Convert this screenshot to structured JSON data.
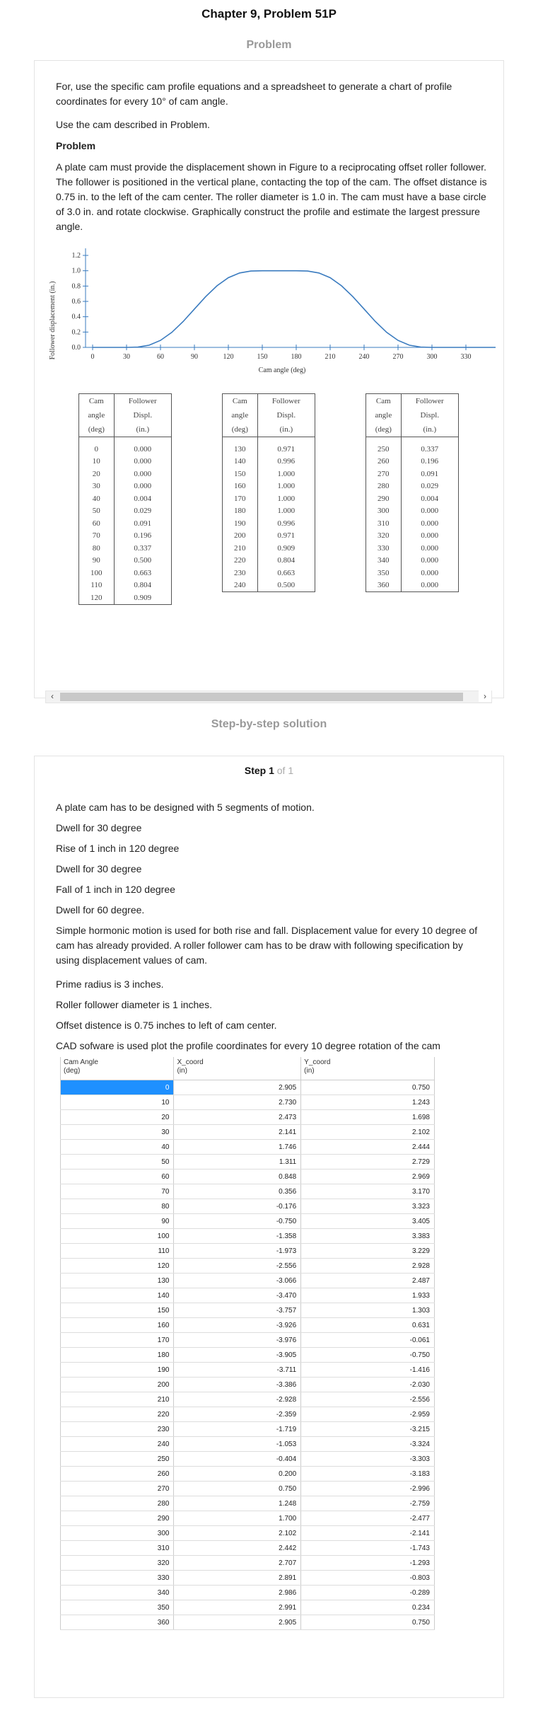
{
  "page_title": "Chapter 9, Problem 51P",
  "problem_section": {
    "heading": "Problem",
    "intro": "For, use the specific cam profile equations and a spreadsheet to generate a chart of profile coordinates for every 10° of cam angle.",
    "use_cam": "Use the cam described in Problem.",
    "problem_label": "Problem",
    "problem_text": "A plate cam must provide the displacement shown in Figure to a reciprocating offset roller follower. The follower is positioned in the vertical plane, contacting the top of the cam. The offset distance is 0.75 in. to the left of the cam center. The roller diameter is 1.0 in. The cam must have a base circle of 3.0 in. and rotate clockwise. Graphically construct the profile and estimate the largest pressure angle.",
    "figure": {
      "ylabel": "Follower displacement (in.)",
      "xlabel": "Cam angle (deg)",
      "yticks": [
        "1.2",
        "1.0",
        "0.8",
        "0.6",
        "0.4",
        "0.2",
        "0.0"
      ],
      "xticks": [
        "0",
        "30",
        "60",
        "90",
        "120",
        "150",
        "180",
        "210",
        "240",
        "270",
        "300",
        "330"
      ],
      "line_color": "#3a7bbf"
    },
    "table_headers": {
      "cam": "Cam",
      "angle": "angle",
      "deg": "(deg)",
      "follower": "Follower",
      "displ": "Displ.",
      "in": "(in.)"
    },
    "table1": [
      [
        "0",
        "0.000"
      ],
      [
        "10",
        "0.000"
      ],
      [
        "20",
        "0.000"
      ],
      [
        "30",
        "0.000"
      ],
      [
        "40",
        "0.004"
      ],
      [
        "50",
        "0.029"
      ],
      [
        "60",
        "0.091"
      ],
      [
        "70",
        "0.196"
      ],
      [
        "80",
        "0.337"
      ],
      [
        "90",
        "0.500"
      ],
      [
        "100",
        "0.663"
      ],
      [
        "110",
        "0.804"
      ],
      [
        "120",
        "0.909"
      ]
    ],
    "table2": [
      [
        "130",
        "0.971"
      ],
      [
        "140",
        "0.996"
      ],
      [
        "150",
        "1.000"
      ],
      [
        "160",
        "1.000"
      ],
      [
        "170",
        "1.000"
      ],
      [
        "180",
        "1.000"
      ],
      [
        "190",
        "0.996"
      ],
      [
        "200",
        "0.971"
      ],
      [
        "210",
        "0.909"
      ],
      [
        "220",
        "0.804"
      ],
      [
        "230",
        "0.663"
      ],
      [
        "240",
        "0.500"
      ]
    ],
    "table3": [
      [
        "250",
        "0.337"
      ],
      [
        "260",
        "0.196"
      ],
      [
        "270",
        "0.091"
      ],
      [
        "280",
        "0.029"
      ],
      [
        "290",
        "0.004"
      ],
      [
        "300",
        "0.000"
      ],
      [
        "310",
        "0.000"
      ],
      [
        "320",
        "0.000"
      ],
      [
        "330",
        "0.000"
      ],
      [
        "340",
        "0.000"
      ],
      [
        "350",
        "0.000"
      ],
      [
        "360",
        "0.000"
      ]
    ],
    "scroll_left": "‹",
    "scroll_right": "›"
  },
  "solution_section": {
    "heading": "Step-by-step solution",
    "step_label": "Step 1",
    "step_of": "of 1",
    "lines": [
      "A plate cam has to be designed with 5 segments of motion.",
      "Dwell for 30 degree",
      "Rise of 1 inch in 120 degree",
      "Dwell for 30 degree",
      "Fall of 1 inch in 120 degree",
      "Dwell for 60 degree."
    ],
    "shm_text": "Simple hormonic motion is used for both rise and fall. Displacement value for every 10 degree of cam has already provided. A roller follower cam has to be draw with following specification by using displacement values of cam.",
    "prime_radius": "Prime radius is 3 inches.",
    "roller_dia": "Roller follower diameter is 1 inches.",
    "offset": "Offset distence is 0.75 inches to left of cam center.",
    "cad": "CAD sofware is used plot the profile coordinates for every 10 degree rotation of the cam",
    "coord_headers": {
      "c0a": "Cam Angle",
      "c0b": "(deg)",
      "c1a": "X_coord",
      "c1b": "(in)",
      "c2a": "Y_coord",
      "c2b": "(in)"
    },
    "coords": [
      [
        "0",
        "2.905",
        "0.750"
      ],
      [
        "10",
        "2.730",
        "1.243"
      ],
      [
        "20",
        "2.473",
        "1.698"
      ],
      [
        "30",
        "2.141",
        "2.102"
      ],
      [
        "40",
        "1.746",
        "2.444"
      ],
      [
        "50",
        "1.311",
        "2.729"
      ],
      [
        "60",
        "0.848",
        "2.969"
      ],
      [
        "70",
        "0.356",
        "3.170"
      ],
      [
        "80",
        "-0.176",
        "3.323"
      ],
      [
        "90",
        "-0.750",
        "3.405"
      ],
      [
        "100",
        "-1.358",
        "3.383"
      ],
      [
        "110",
        "-1.973",
        "3.229"
      ],
      [
        "120",
        "-2.556",
        "2.928"
      ],
      [
        "130",
        "-3.066",
        "2.487"
      ],
      [
        "140",
        "-3.470",
        "1.933"
      ],
      [
        "150",
        "-3.757",
        "1.303"
      ],
      [
        "160",
        "-3.926",
        "0.631"
      ],
      [
        "170",
        "-3.976",
        "-0.061"
      ],
      [
        "180",
        "-3.905",
        "-0.750"
      ],
      [
        "190",
        "-3.711",
        "-1.416"
      ],
      [
        "200",
        "-3.386",
        "-2.030"
      ],
      [
        "210",
        "-2.928",
        "-2.556"
      ],
      [
        "220",
        "-2.359",
        "-2.959"
      ],
      [
        "230",
        "-1.719",
        "-3.215"
      ],
      [
        "240",
        "-1.053",
        "-3.324"
      ],
      [
        "250",
        "-0.404",
        "-3.303"
      ],
      [
        "260",
        "0.200",
        "-3.183"
      ],
      [
        "270",
        "0.750",
        "-2.996"
      ],
      [
        "280",
        "1.248",
        "-2.759"
      ],
      [
        "290",
        "1.700",
        "-2.477"
      ],
      [
        "300",
        "2.102",
        "-2.141"
      ],
      [
        "310",
        "2.442",
        "-1.743"
      ],
      [
        "320",
        "2.707",
        "-1.293"
      ],
      [
        "330",
        "2.891",
        "-0.803"
      ],
      [
        "340",
        "2.986",
        "-0.289"
      ],
      [
        "350",
        "2.991",
        "0.234"
      ],
      [
        "360",
        "2.905",
        "0.750"
      ]
    ]
  }
}
